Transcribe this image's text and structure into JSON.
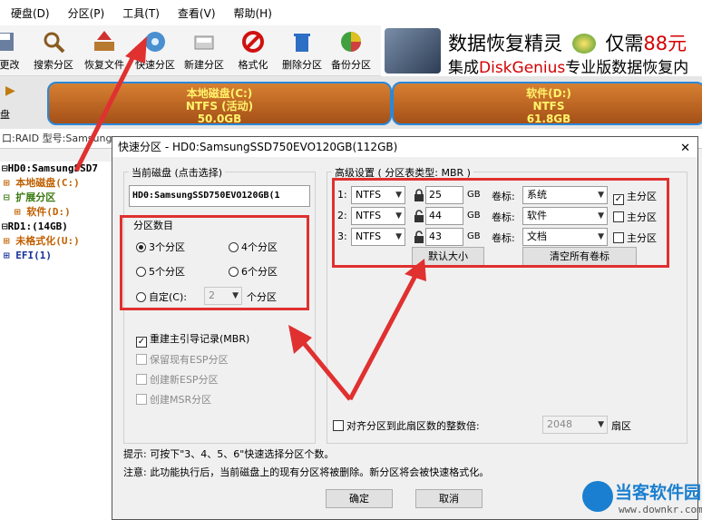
{
  "menu": [
    "硬盘(D)",
    "分区(P)",
    "工具(T)",
    "查看(V)",
    "帮助(H)"
  ],
  "toolbar": {
    "items": [
      {
        "label": "存更改",
        "icon": "save-icon"
      },
      {
        "label": "搜索分区",
        "icon": "search-icon"
      },
      {
        "label": "恢复文件",
        "icon": "recover-files-icon"
      },
      {
        "label": "快速分区",
        "icon": "quick-partition-icon"
      },
      {
        "label": "新建分区",
        "icon": "new-partition-icon"
      },
      {
        "label": "格式化",
        "icon": "format-icon"
      },
      {
        "label": "删除分区",
        "icon": "delete-partition-icon"
      },
      {
        "label": "备份分区",
        "icon": "backup-partition-icon"
      }
    ]
  },
  "banner": {
    "line1_a": "数据恢复精灵",
    "line1_b": "仅需",
    "line1_price": "88元",
    "line2_a": "集成",
    "line2_brand": "DiskGenius",
    "line2_b": "专业版数据恢复内"
  },
  "diskmap": {
    "left_label": "盘",
    "partitions": [
      {
        "name": "本地磁盘(C:)",
        "fs": "NTFS (活动)",
        "size": "50.0GB"
      },
      {
        "name": "软件(D:)",
        "fs": "NTFS",
        "size": "61.8GB"
      }
    ]
  },
  "infoline": "口:RAID  型号:Samsung",
  "tree": {
    "items": [
      {
        "text": "HD0:SamsungSSD7",
        "color": "#000000"
      },
      {
        "text": "本地磁盘(C:)",
        "color": "#c06000"
      },
      {
        "text": "扩展分区",
        "color": "#3a7a10"
      },
      {
        "text": "软件(D:)",
        "color": "#c06000"
      },
      {
        "text": "RD1:(14GB)",
        "color": "#000000"
      },
      {
        "text": "未格式化(U:)",
        "color": "#c06000"
      },
      {
        "text": "EFI(1)",
        "color": "#14309a"
      }
    ]
  },
  "dialog": {
    "title": "快速分区 - HD0:SamsungSSD750EVO120GB(112GB)",
    "close": "✕",
    "current_disk_label": "当前磁盘 (点击选择)",
    "current_disk_value": "HD0:SamsungSSD750EVO120GB(1",
    "partition_count": {
      "label": "分区数目",
      "options": [
        "3个分区",
        "4个分区",
        "5个分区",
        "6个分区"
      ],
      "selected": "3个分区",
      "custom_label": "自定(C):",
      "custom_value": "2",
      "custom_suffix": "个分区"
    },
    "options": {
      "rebuild_mbr": "重建主引导记录(MBR)",
      "keep_esp": "保留现有ESP分区",
      "create_esp": "创建新ESP分区",
      "create_msr": "创建MSR分区"
    },
    "advanced": {
      "label": "高级设置 ( 分区表类型: MBR )",
      "rows": [
        {
          "index": "1:",
          "fs": "NTFS",
          "size": "25",
          "unit": "GB",
          "vol_label": "卷标:",
          "name": "系统",
          "primary": "主分区",
          "primary_checked": true
        },
        {
          "index": "2:",
          "fs": "NTFS",
          "size": "44",
          "unit": "GB",
          "vol_label": "卷标:",
          "name": "软件",
          "primary": "主分区",
          "primary_checked": false
        },
        {
          "index": "3:",
          "fs": "NTFS",
          "size": "43",
          "unit": "GB",
          "vol_label": "卷标:",
          "name": "文档",
          "primary": "主分区",
          "primary_checked": false
        }
      ],
      "default_size_btn": "默认大小",
      "clear_labels_btn": "清空所有卷标"
    },
    "align": {
      "label": "对齐分区到此扇区数的整数倍:",
      "value": "2048",
      "suffix": "扇区"
    },
    "tip": "提示: 可按下\"3、4、5、6\"快速选择分区个数。",
    "note": "注意: 此功能执行后，当前磁盘上的现有分区将被删除。新分区将会被快速格式化。",
    "ok": "确定",
    "cancel": "取消"
  },
  "watermark": {
    "title": "当客软件园",
    "url": "www.downkr.com"
  },
  "colors": {
    "annotation_red": "#e03030",
    "partition_fill": "#c0682a",
    "partition_border": "#2a88d8",
    "partition_text": "#fff36a"
  }
}
